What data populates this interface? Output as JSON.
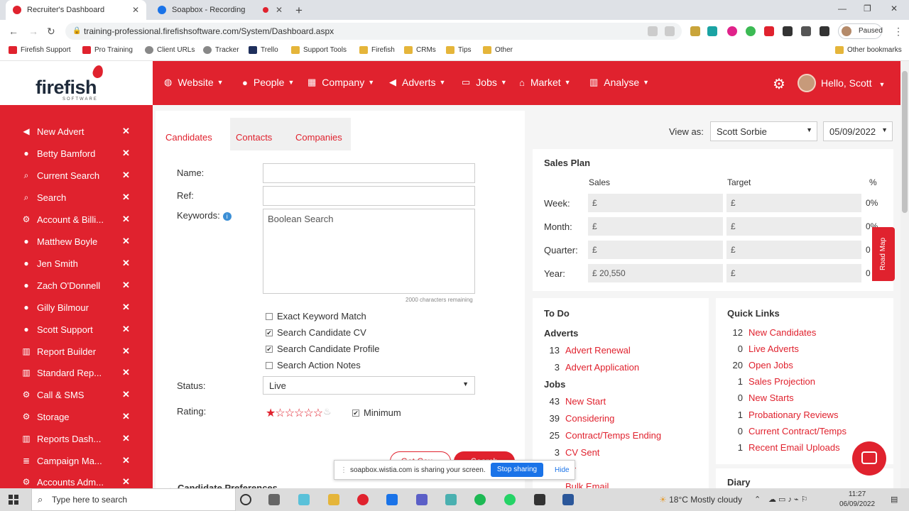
{
  "browser": {
    "tabs": [
      {
        "label": "Recruiter's Dashboard",
        "active": true
      },
      {
        "label": "Soapbox - Recording",
        "active": false
      }
    ],
    "url": "training-professional.firefishsoftware.com/System/Dashboard.aspx",
    "profile_status": "Paused",
    "bookmarks": [
      "Firefish Support",
      "Pro Training",
      "Client URLs",
      "Tracker",
      "Trello",
      "Support Tools",
      "Firefish",
      "CRMs",
      "Tips",
      "Other"
    ],
    "other_bookmarks": "Other bookmarks"
  },
  "logo": {
    "word": "firefish",
    "sub": "SOFTWARE"
  },
  "nav": {
    "items": [
      "Website",
      "People",
      "Company",
      "Adverts",
      "Jobs",
      "Market",
      "Analyse"
    ],
    "greeting": "Hello, Scott"
  },
  "sidebar": {
    "items": [
      "New Advert",
      "Betty Bamford",
      "Current Search",
      "Search",
      "Account & Billi...",
      "Matthew Boyle",
      "Jen Smith",
      "Zach O'Donnell",
      "Gilly Bilmour",
      "Scott Support",
      "Report Builder",
      "Standard Rep...",
      "Call & SMS",
      "Storage",
      "Reports Dash...",
      "Campaign Ma...",
      "Accounts Adm..."
    ],
    "close_glyph": "✕"
  },
  "search": {
    "tabs": [
      "Candidates",
      "Contacts",
      "Companies"
    ],
    "name_label": "Name:",
    "ref_label": "Ref:",
    "keywords_label": "Keywords:",
    "keywords_placeholder": "Boolean Search",
    "chars_remaining": "2000 characters remaining",
    "checks": [
      {
        "label": "Exact Keyword Match",
        "checked": false
      },
      {
        "label": "Search Candidate CV",
        "checked": true
      },
      {
        "label": "Search Candidate Profile",
        "checked": true
      },
      {
        "label": "Search Action Notes",
        "checked": false
      }
    ],
    "status_label": "Status:",
    "status_value": "Live",
    "rating_label": "Rating:",
    "rating": 1,
    "rating_max": 6,
    "minimum_label": "Minimum",
    "count_button": "Get Cou...",
    "search_button": "Search",
    "preferences": "Candidate Preferences"
  },
  "viewas": {
    "label": "View as:",
    "user": "Scott Sorbie",
    "date": "05/09/2022"
  },
  "sales_plan": {
    "title": "Sales Plan",
    "cols": [
      "Sales",
      "Target",
      "%"
    ],
    "rows": [
      {
        "label": "Week:",
        "sales": "£",
        "target": "£",
        "pct": "0%"
      },
      {
        "label": "Month:",
        "sales": "£",
        "target": "£",
        "pct": "0%"
      },
      {
        "label": "Quarter:",
        "sales": "£",
        "target": "£",
        "pct": "0"
      },
      {
        "label": "Year:",
        "sales": "£ 20,550",
        "target": "£",
        "pct": "0"
      }
    ]
  },
  "roadmap": "Road Map",
  "todo": {
    "title": "To Do",
    "sections": [
      {
        "name": "Adverts",
        "items": [
          {
            "count": "13",
            "label": "Advert Renewal"
          },
          {
            "count": "3",
            "label": "Advert Application"
          }
        ]
      },
      {
        "name": "Jobs",
        "items": [
          {
            "count": "43",
            "label": "New Start"
          },
          {
            "count": "39",
            "label": "Considering"
          },
          {
            "count": "25",
            "label": "Contract/Temps Ending"
          },
          {
            "count": "3",
            "label": "CV Sent"
          },
          {
            "count": "",
            "label": "fer"
          },
          {
            "count": "",
            "label": "Bulk Email"
          }
        ]
      }
    ]
  },
  "quick_links": {
    "title": "Quick Links",
    "items": [
      {
        "count": "12",
        "label": "New Candidates"
      },
      {
        "count": "0",
        "label": "Live Adverts"
      },
      {
        "count": "20",
        "label": "Open Jobs"
      },
      {
        "count": "1",
        "label": "Sales Projection"
      },
      {
        "count": "0",
        "label": "New Starts"
      },
      {
        "count": "1",
        "label": "Probationary Reviews"
      },
      {
        "count": "0",
        "label": "Current Contract/Temps"
      },
      {
        "count": "1",
        "label": "Recent Email Uploads"
      }
    ]
  },
  "diary": "Diary",
  "share_bar": {
    "text": "soapbox.wistia.com is sharing your screen.",
    "stop": "Stop sharing",
    "hide": "Hide"
  },
  "taskbar": {
    "search_placeholder": "Type here to search",
    "weather": "18°C  Mostly cloudy",
    "time": "11:27",
    "date": "06/09/2022"
  },
  "colors": {
    "brand": "#e0222e",
    "share_blue": "#1a73e8"
  }
}
